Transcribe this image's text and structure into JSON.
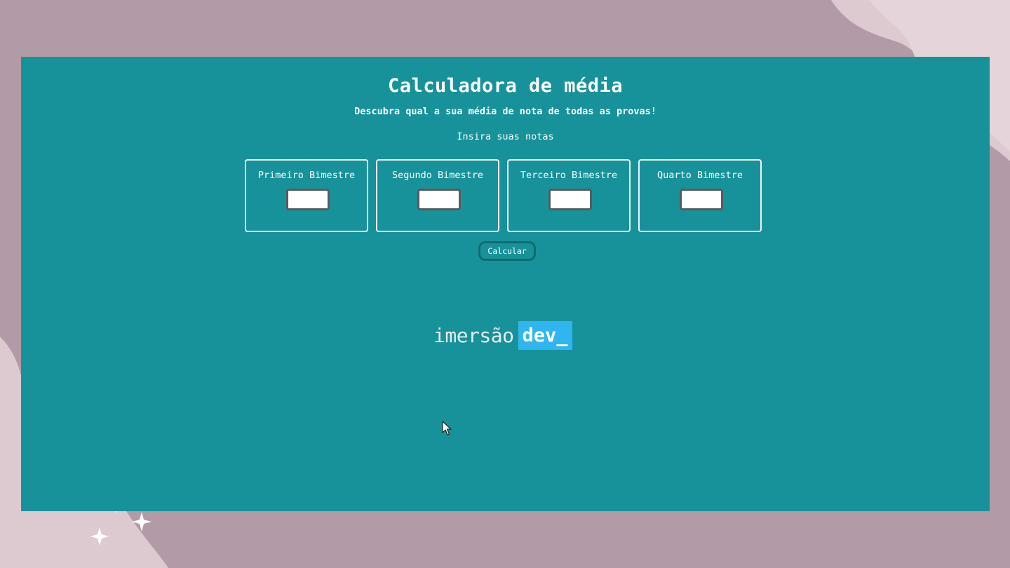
{
  "colors": {
    "page_background": "#b29ba6",
    "blob": "#ddcad0",
    "app_background": "#17929a",
    "logo_highlight": "#2fb6f0"
  },
  "header": {
    "title": "Calculadora de média",
    "subtitle": "Descubra qual a sua média de nota de todas as provas!"
  },
  "form": {
    "instruction": "Insira suas notas",
    "fields": [
      {
        "label": "Primeiro Bimestre",
        "value": ""
      },
      {
        "label": "Segundo Bimestre",
        "value": ""
      },
      {
        "label": "Terceiro Bimestre",
        "value": ""
      },
      {
        "label": "Quarto Bimestre",
        "value": ""
      }
    ],
    "calculate_label": "Calcular"
  },
  "brand": {
    "word": "imersão",
    "highlight": "dev_"
  },
  "icons": {
    "cursor": "mouse-pointer-icon",
    "decor": "sparkle-icon"
  }
}
